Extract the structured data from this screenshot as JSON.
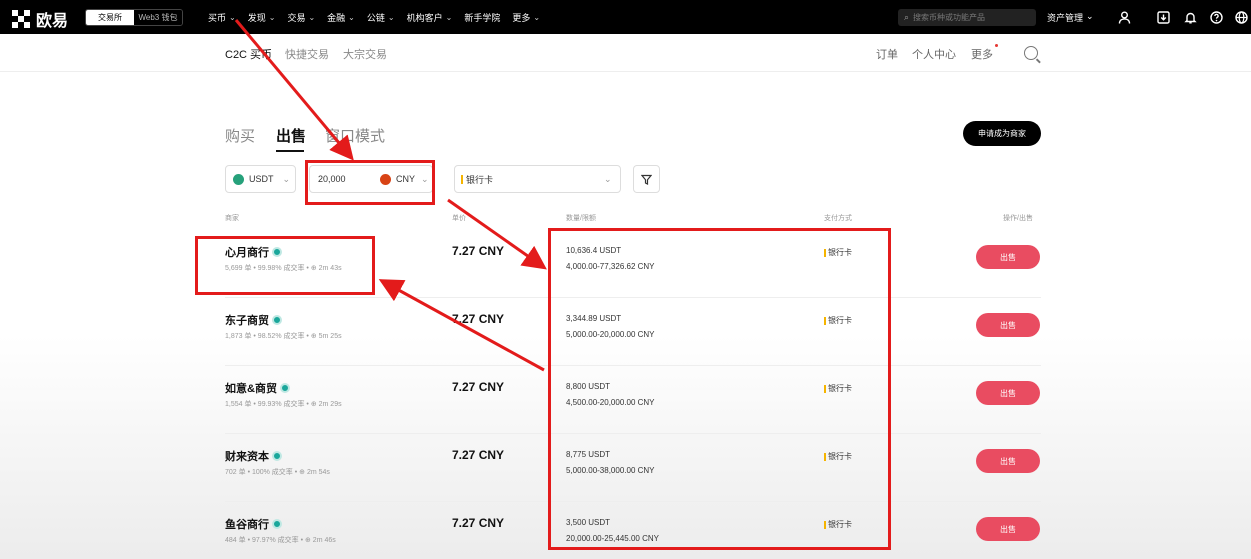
{
  "topbar": {
    "logo_text": "欧易",
    "mode_exchange": "交易所",
    "mode_web3": "Web3 钱包",
    "nav": [
      "买币",
      "发现",
      "交易",
      "金融",
      "公链",
      "机构客户",
      "新手学院",
      "更多"
    ],
    "nav_has_chevron": [
      true,
      true,
      true,
      true,
      true,
      true,
      false,
      true
    ],
    "search_placeholder": "搜索币种或功能产品",
    "assets_label": "资产管理"
  },
  "subnav": {
    "tabs": [
      "C2C 买币",
      "快捷交易",
      "大宗交易"
    ],
    "active_tab": "C2C 买币",
    "right": [
      "订单",
      "个人中心",
      "更多"
    ]
  },
  "trade": {
    "tabs": [
      "购买",
      "出售",
      "窗口模式"
    ],
    "active": "出售",
    "merchant_button": "申请成为商家"
  },
  "filters": {
    "coin": "USDT",
    "amount": "20,000",
    "currency": "CNY",
    "payment": "银行卡"
  },
  "table": {
    "headers": [
      "商家",
      "单价",
      "数量/限额",
      "支付方式",
      "操作/出售"
    ],
    "sell_label": "出售",
    "rows": [
      {
        "name": "心月商行",
        "stats": "5,699 单 • 99.98% 成交率 • ⊕ 2m 43s",
        "price": "7.27 CNY",
        "available": "10,636.4 USDT",
        "limit": "4,000.00-77,326.62 CNY",
        "payment": "银行卡"
      },
      {
        "name": "东子商贸",
        "stats": "1,873 单 • 98.52% 成交率 • ⊕ 5m 25s",
        "price": "7.27 CNY",
        "available": "3,344.89 USDT",
        "limit": "5,000.00-20,000.00 CNY",
        "payment": "银行卡"
      },
      {
        "name": "如意&商贸",
        "stats": "1,554 单 • 99.93% 成交率 • ⊕ 2m 29s",
        "price": "7.27 CNY",
        "available": "8,800 USDT",
        "limit": "4,500.00-20,000.00 CNY",
        "payment": "银行卡"
      },
      {
        "name": "财来资本",
        "stats": "702 单 • 100% 成交率 • ⊕ 2m 54s",
        "price": "7.27 CNY",
        "available": "8,775 USDT",
        "limit": "5,000.00-38,000.00 CNY",
        "payment": "银行卡"
      },
      {
        "name": "鱼谷商行",
        "stats": "484 单 • 97.97% 成交率 • ⊕ 2m 46s",
        "price": "7.27 CNY",
        "available": "3,500 USDT",
        "limit": "20,000.00-25,445.00 CNY",
        "payment": "银行卡"
      }
    ]
  },
  "annotation_color": "#e31b1b"
}
